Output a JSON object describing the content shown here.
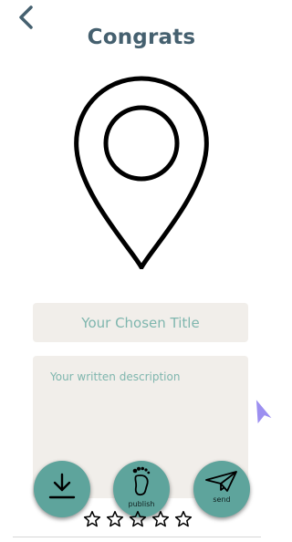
{
  "header": {
    "title": "Congrats"
  },
  "icons": {
    "back": "chevron-left-icon",
    "location": "map-pin-icon",
    "download": "download-icon",
    "publish": "footprint-icon",
    "send": "paper-plane-icon",
    "star": "star-outline-icon",
    "cursor": "pointer-cursor-icon"
  },
  "form": {
    "title_placeholder": "Your Chosen Title",
    "description_placeholder": "Your written description"
  },
  "actions": {
    "publish_label": "publish",
    "send_label": "send"
  },
  "rating": {
    "value": 0,
    "max": 5
  },
  "colors": {
    "heading": "#45606f",
    "accent": "#5ea49c",
    "field_background": "#f1eeea",
    "placeholder": "#7fb6ae"
  }
}
